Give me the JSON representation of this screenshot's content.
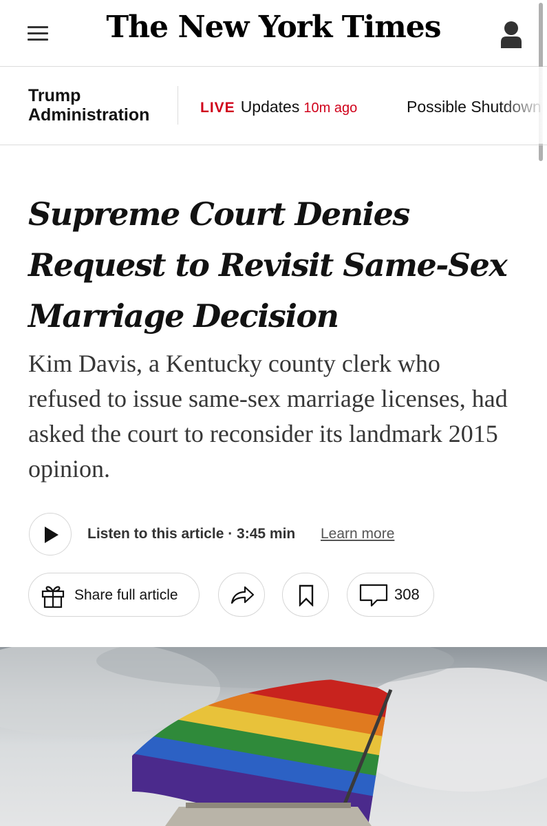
{
  "header": {
    "logo": "The New York Times",
    "menu_icon": "hamburger-menu-icon",
    "account_icon": "account-icon"
  },
  "section_bar": {
    "section": "Trump Administration",
    "live_badge": "LIVE",
    "live_label": "Updates",
    "live_time": "10m ago",
    "next_item": "Possible Shutdown"
  },
  "article": {
    "headline": "Supreme Court Denies Request to Revisit Same-Sex Marriage Decision",
    "summary": "Kim Davis, a Kentucky county clerk who refused to issue same-sex marriage licenses, had asked the court to reconsider its landmark 2015 opinion."
  },
  "listen": {
    "label": "Listen to this article · 3:45 min",
    "learn_more": "Learn more",
    "play_icon": "play-icon"
  },
  "actions": {
    "share_full_label": "Share full article",
    "gift_icon": "gift-icon",
    "share_icon": "share-arrow-icon",
    "save_icon": "bookmark-icon",
    "comments_icon": "comment-bubble-icon",
    "comments_count": "308"
  },
  "hero": {
    "description_icon": "rainbow-flag-photo"
  },
  "colors": {
    "accent_red": "#d0021b",
    "text": "#121212",
    "border": "#dcdcdc"
  }
}
